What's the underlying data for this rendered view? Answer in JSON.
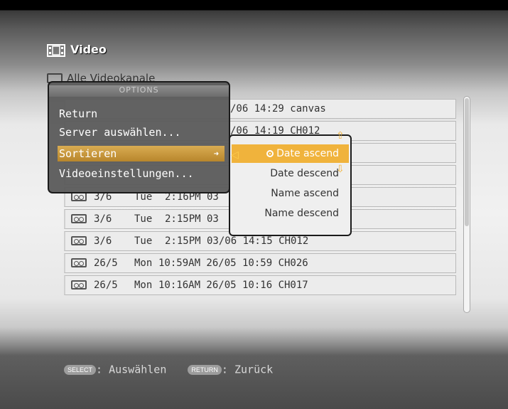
{
  "header": {
    "title": "Video",
    "icon": "film-icon"
  },
  "folder": {
    "label": "Alle Videokanale"
  },
  "rows": [
    {
      "text": "                          /06 14:29 canvas"
    },
    {
      "text": "                          /06 14:19 CH012"
    },
    {
      "text": ""
    },
    {
      "text": ""
    },
    {
      "date": "3/6",
      "day": "Tue",
      "time": "2:16PM 03"
    },
    {
      "date": "3/6",
      "day": "Tue",
      "time": "2:15PM 03"
    },
    {
      "date": "3/6",
      "day": "Tue",
      "time": "2:15PM 03/06 14:15 CH012"
    },
    {
      "date": "26/5",
      "day": "Mon",
      "time": "10:59AM 26/05 10:59 CH026"
    },
    {
      "date": "26/5",
      "day": "Mon",
      "time": "10:16AM 26/05 10:16 CH017"
    }
  ],
  "options": {
    "title": "OPTIONS",
    "items": [
      "Return",
      "Server auswählen...",
      "Sortieren",
      "Videoeinstellungen..."
    ],
    "selected_index": 2
  },
  "sort_menu": {
    "items": [
      "Date ascend",
      "Date descend",
      "Name ascend",
      "Name descend"
    ],
    "selected_index": 0
  },
  "footer": {
    "select_button": "SELECT",
    "select_label": ": Auswählen",
    "return_button": "RETURN",
    "return_label": ": Zurück"
  }
}
